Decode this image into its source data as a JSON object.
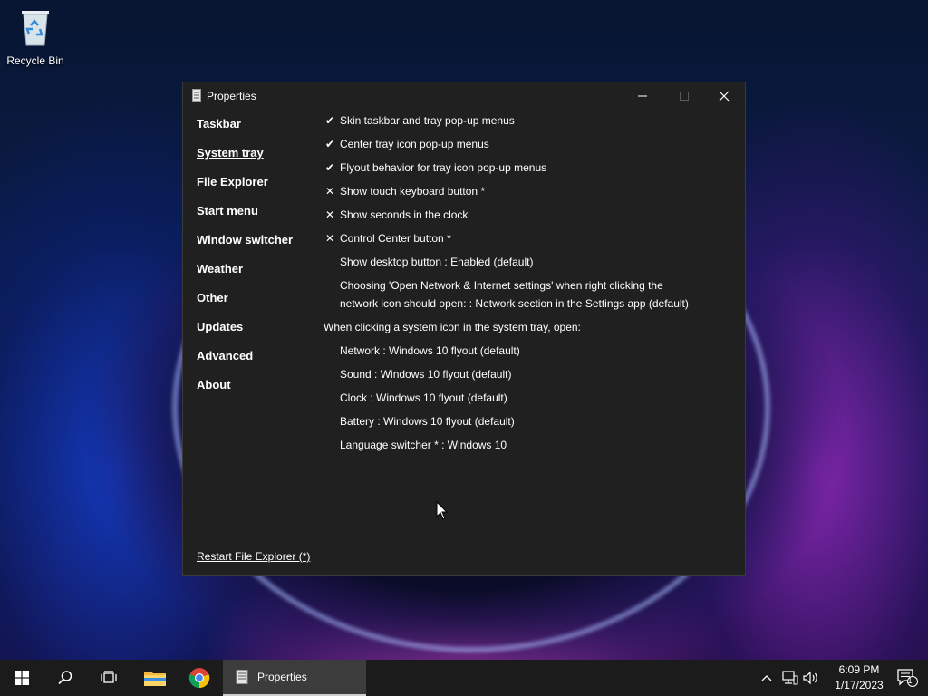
{
  "desktop": {
    "recycle_bin_label": "Recycle Bin"
  },
  "window": {
    "title": "Properties",
    "controls": [
      "minimize",
      "maximize",
      "close"
    ]
  },
  "nav": {
    "items": [
      {
        "label": "Taskbar",
        "active": false
      },
      {
        "label": "System tray",
        "active": true
      },
      {
        "label": "File Explorer",
        "active": false
      },
      {
        "label": "Start menu",
        "active": false
      },
      {
        "label": "Window switcher",
        "active": false
      },
      {
        "label": "Weather",
        "active": false
      },
      {
        "label": "Other",
        "active": false
      },
      {
        "label": "Updates",
        "active": false
      },
      {
        "label": "Advanced",
        "active": false
      },
      {
        "label": "About",
        "active": false
      }
    ]
  },
  "settings": {
    "toggles": [
      {
        "mark": "✔",
        "label": "Skin taskbar and tray pop-up menus",
        "enabled": true
      },
      {
        "mark": "✔",
        "label": "Center tray icon pop-up menus",
        "enabled": true
      },
      {
        "mark": "✔",
        "label": "Flyout behavior for tray icon pop-up menus",
        "enabled": true
      },
      {
        "mark": "✕",
        "label": "Show touch keyboard button *",
        "enabled": false
      },
      {
        "mark": "✕",
        "label": "Show seconds in the clock",
        "enabled": false
      },
      {
        "mark": "✕",
        "label": "Control Center button *",
        "enabled": false
      }
    ],
    "show_desktop": "Show desktop button : Enabled (default)",
    "network_settings_line1": "Choosing 'Open Network & Internet settings' when right clicking the",
    "network_settings_line2": "network icon should open: : Network section in the Settings app (default)",
    "system_icon_heading": "When clicking a system icon in the system tray, open:",
    "system_icons": [
      "Network : Windows 10 flyout (default)",
      "Sound : Windows 10 flyout (default)",
      "Clock : Windows 10 flyout (default)",
      "Battery : Windows 10 flyout (default)",
      "Language switcher * : Windows 10"
    ]
  },
  "footer": {
    "restart_link": "Restart File Explorer (*)"
  },
  "taskbar": {
    "active_app_label": "Properties",
    "clock_time": "6:09 PM",
    "clock_date": "1/17/2023",
    "notification_count": "1"
  },
  "colors": {
    "window_bg": "#202020",
    "taskbar_bg": "#1b1b1b",
    "active_task_bg": "#3c3c3c"
  }
}
